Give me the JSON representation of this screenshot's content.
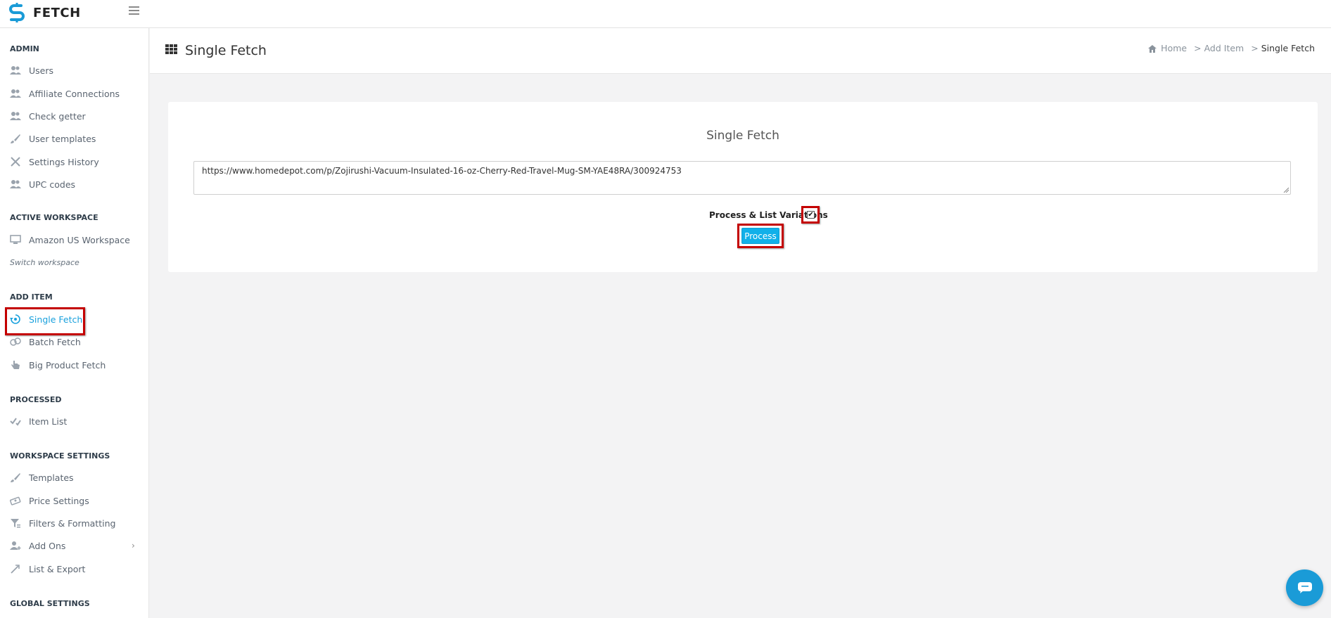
{
  "app": {
    "logo_text": "FETCH",
    "brand_color": "#1a9bd7",
    "accent_color": "#11b0e9",
    "highlight_color": "#d60000"
  },
  "sidebar": {
    "sections": [
      {
        "heading": "ADMIN",
        "items": [
          {
            "label": "Users",
            "icon": "users-icon",
            "active": false
          },
          {
            "label": "Affiliate Connections",
            "icon": "users-icon",
            "active": false
          },
          {
            "label": "Check getter",
            "icon": "users-icon",
            "active": false
          },
          {
            "label": "User templates",
            "icon": "brush-icon",
            "active": false
          },
          {
            "label": "Settings History",
            "icon": "tools-icon",
            "active": false
          },
          {
            "label": "UPC codes",
            "icon": "users-icon",
            "active": false
          }
        ]
      },
      {
        "heading": "ACTIVE WORKSPACE",
        "items": [
          {
            "label": "Amazon US Workspace",
            "icon": "monitor-icon",
            "active": false
          }
        ],
        "link": "Switch workspace"
      },
      {
        "heading": "ADD ITEM",
        "items": [
          {
            "label": "Single Fetch",
            "icon": "single-fetch-icon",
            "active": true
          },
          {
            "label": "Batch Fetch",
            "icon": "batch-fetch-icon",
            "active": false
          },
          {
            "label": "Big Product Fetch",
            "icon": "hand-pointer-icon",
            "active": false
          }
        ]
      },
      {
        "heading": "PROCESSED",
        "items": [
          {
            "label": "Item List",
            "icon": "checklist-icon",
            "active": false
          }
        ]
      },
      {
        "heading": "WORKSPACE SETTINGS",
        "items": [
          {
            "label": "Templates",
            "icon": "brush-icon",
            "active": false
          },
          {
            "label": "Price Settings",
            "icon": "money-icon",
            "active": false
          },
          {
            "label": "Filters & Formatting",
            "icon": "filter-icon",
            "active": false
          },
          {
            "label": "Add Ons",
            "icon": "user-plus-icon",
            "active": false,
            "chevron": true
          },
          {
            "label": "List & Export",
            "icon": "export-icon",
            "active": false
          }
        ]
      },
      {
        "heading": "GLOBAL SETTINGS",
        "items": []
      }
    ]
  },
  "header": {
    "page_title": "Single Fetch",
    "breadcrumb": {
      "home": "Home",
      "sep": ">",
      "parent": "Add Item",
      "current": "Single Fetch"
    }
  },
  "card": {
    "title": "Single Fetch",
    "url_value": "https://www.homedepot.com/p/Zojirushi-Vacuum-Insulated-16-oz-Cherry-Red-Travel-Mug-SM-YAE48RA/300924753",
    "checkbox_label": "Process & List Variations",
    "checkbox_checked": true,
    "process_label": "Process"
  }
}
